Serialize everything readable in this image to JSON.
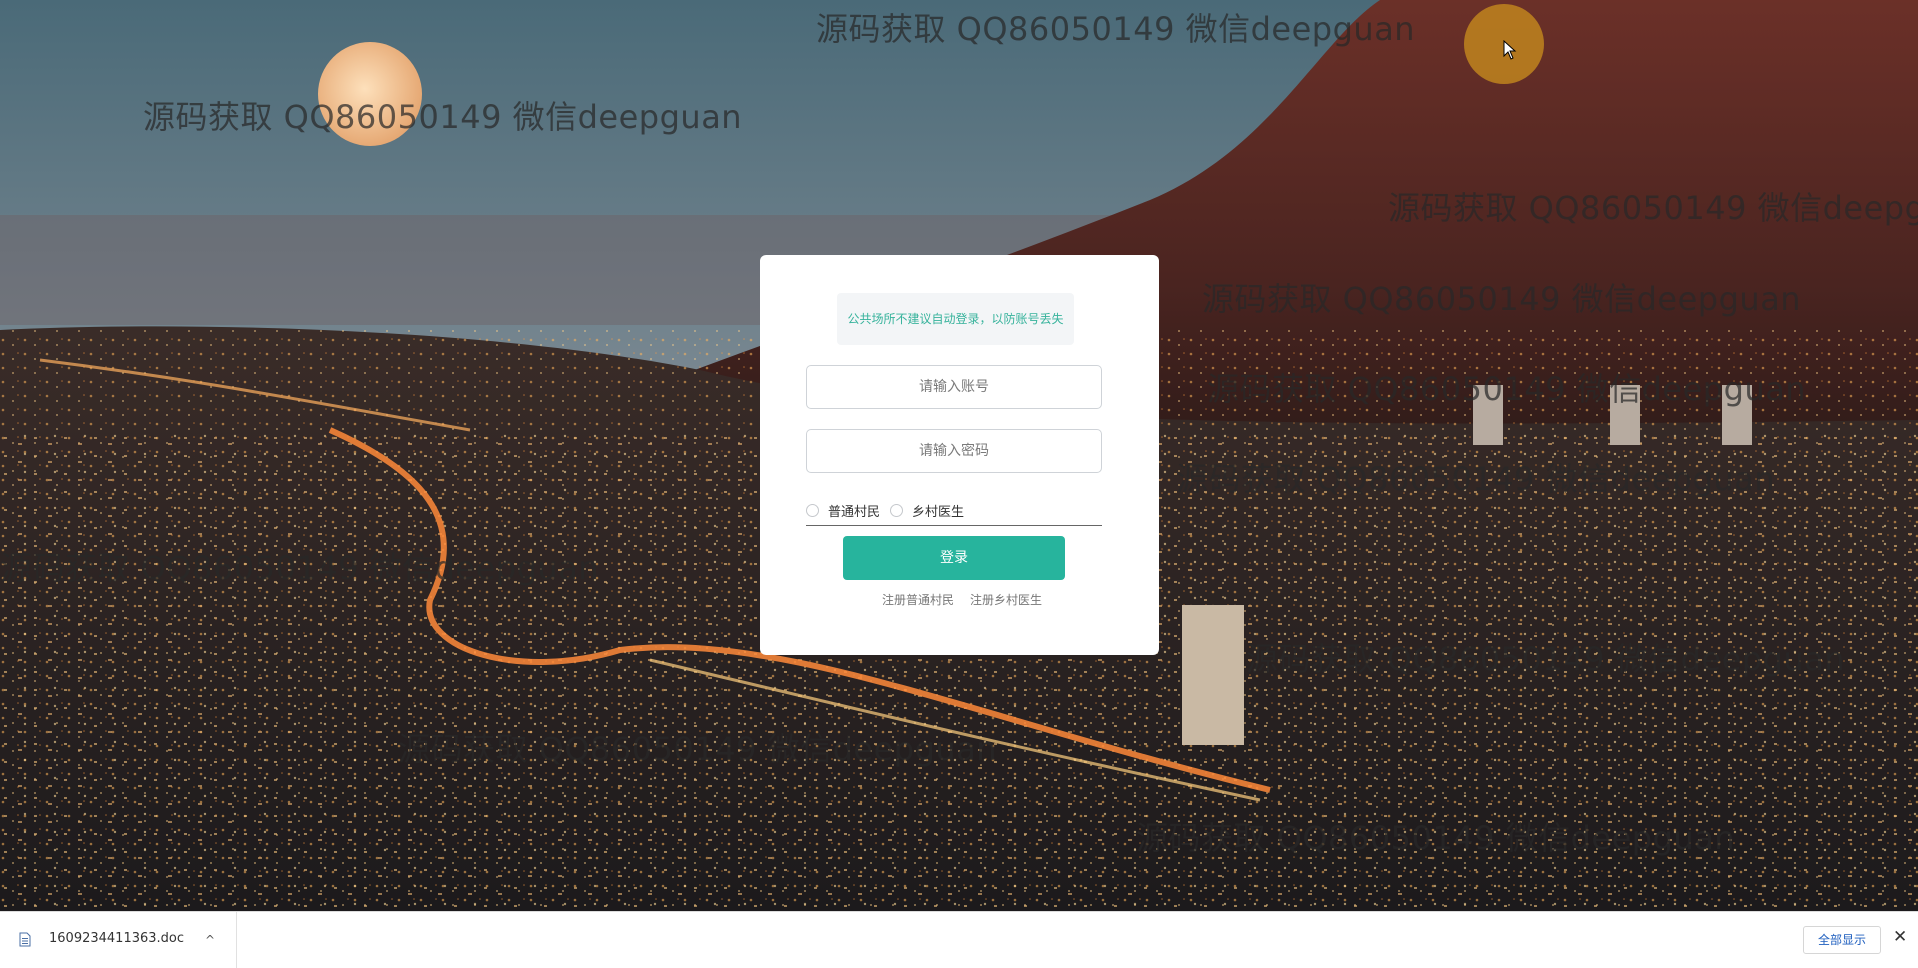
{
  "watermark_text": "源码获取 QQ86050149 微信deepguan",
  "login": {
    "notice": "公共场所不建议自动登录，以防账号丢失",
    "account_placeholder": "请输入账号",
    "password_placeholder": "请输入密码",
    "roles": [
      "普通村民",
      "乡村医生"
    ],
    "login_button": "登录",
    "register_villager": "注册普通村民",
    "register_doctor": "注册乡村医生"
  },
  "download_bar": {
    "file_name": "1609234411363.doc",
    "show_all": "全部显示",
    "close": "✕",
    "chevron": "^"
  },
  "colors": {
    "accent": "#27b49d",
    "notice_text": "#37b39c"
  }
}
